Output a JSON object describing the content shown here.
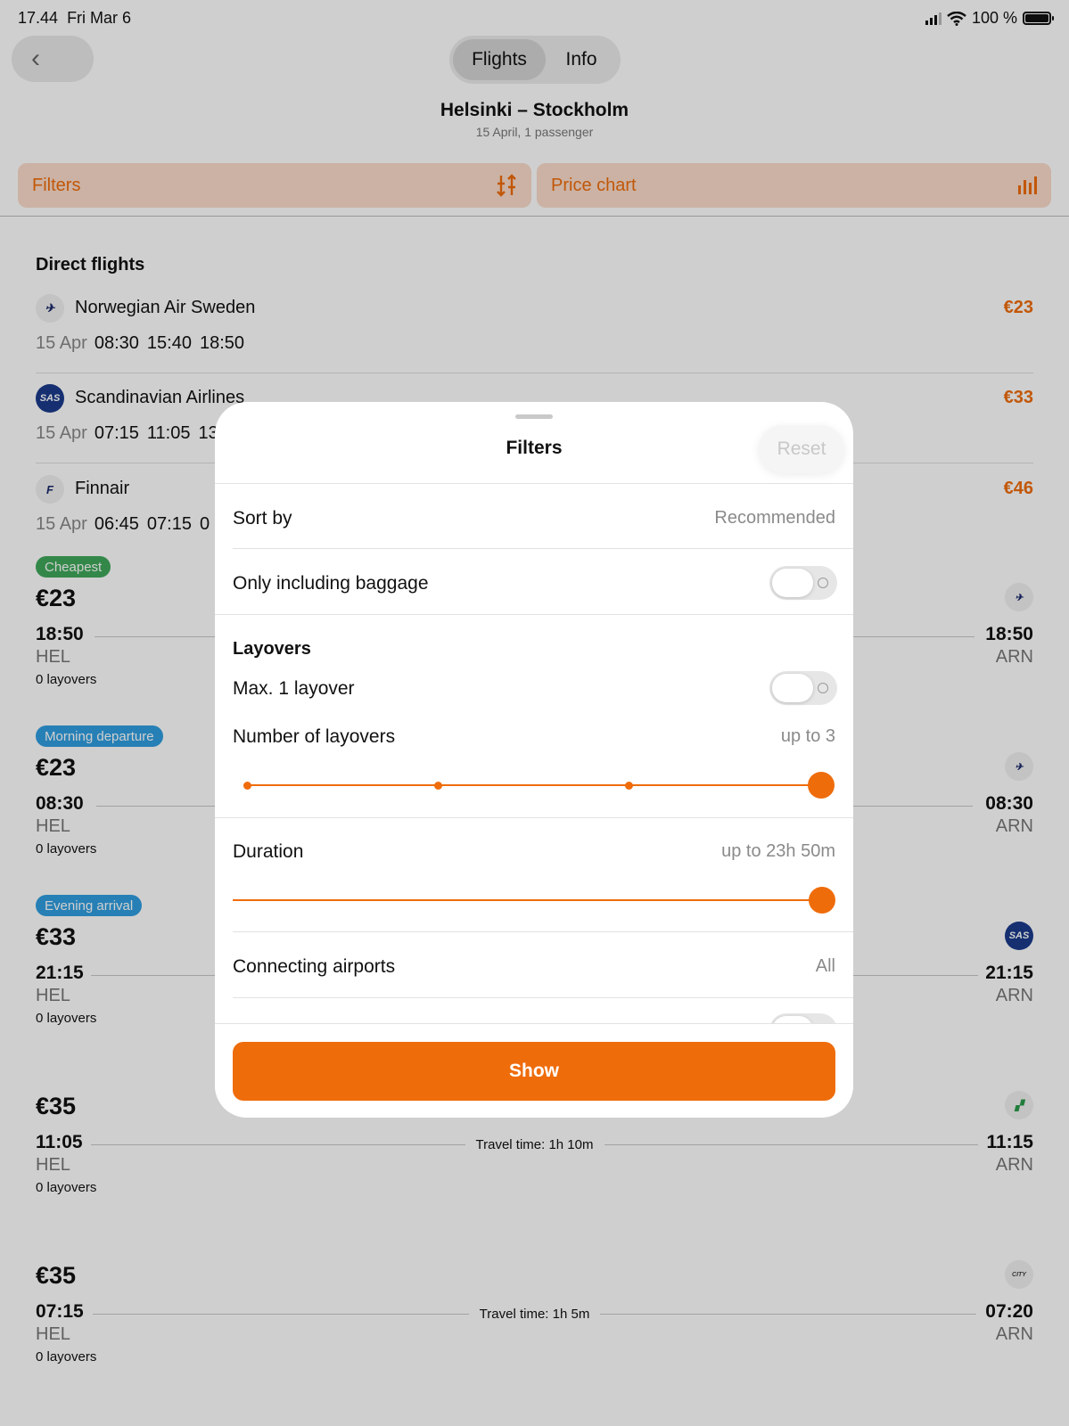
{
  "status": {
    "time": "17.44",
    "date": "Fri Mar 6",
    "battery": "100 %"
  },
  "header": {
    "tabs": [
      {
        "label": "Flights",
        "active": true
      },
      {
        "label": "Info",
        "active": false
      }
    ],
    "route": "Helsinki – Stockholm",
    "sub": "15 April, 1 passenger",
    "filters_label": "Filters",
    "price_chart_label": "Price chart"
  },
  "direct": {
    "title": "Direct flights",
    "rows": [
      {
        "airline": "Norwegian Air Sweden",
        "price": "€23",
        "date": "15 Apr",
        "times": [
          "08:30",
          "15:40",
          "18:50"
        ]
      },
      {
        "airline": "Scandinavian Airlines",
        "price": "€33",
        "date": "15 Apr",
        "times": [
          "07:15",
          "11:05",
          "13"
        ]
      },
      {
        "airline": "Finnair",
        "price": "€46",
        "date": "15 Apr",
        "times": [
          "06:45",
          "07:15",
          "0"
        ]
      }
    ]
  },
  "flights": [
    {
      "badge": "Cheapest",
      "badge_color": "#3fa85a",
      "price": "€23",
      "dep": "18:50",
      "arr": "18:50",
      "from": "HEL",
      "to": "ARN",
      "layovers": "0 layovers",
      "travel": ""
    },
    {
      "badge": "Morning departure",
      "badge_color": "#2f9ee0",
      "price": "€23",
      "dep": "08:30",
      "arr": "08:30",
      "from": "HEL",
      "to": "ARN",
      "layovers": "0 layovers",
      "travel": ""
    },
    {
      "badge": "Evening arrival",
      "badge_color": "#2f9ee0",
      "price": "€33",
      "dep": "21:15",
      "arr": "21:15",
      "from": "HEL",
      "to": "ARN",
      "layovers": "0 layovers",
      "travel": ""
    },
    {
      "badge": "",
      "price": "€35",
      "dep": "11:05",
      "arr": "11:15",
      "from": "HEL",
      "to": "ARN",
      "layovers": "0 layovers",
      "travel": "Travel time: 1h 10m"
    },
    {
      "badge": "",
      "price": "€35",
      "dep": "07:15",
      "arr": "07:20",
      "from": "HEL",
      "to": "ARN",
      "layovers": "0 layovers",
      "travel": "Travel time: 1h 5m"
    }
  ],
  "modal": {
    "title": "Filters",
    "reset": "Reset",
    "sort_label": "Sort by",
    "sort_value": "Recommended",
    "baggage_label": "Only including baggage",
    "baggage_on": false,
    "layovers_heading": "Layovers",
    "max_layover_label": "Max. 1 layover",
    "max_layover_on": false,
    "num_layovers_label": "Number of layovers",
    "num_layovers_value": "up to 3",
    "num_layovers_selected": 3,
    "num_layovers_max": 3,
    "duration_label": "Duration",
    "duration_value": "up to 23h 50m",
    "duration_fraction": 1.0,
    "airports_label": "Connecting airports",
    "airports_value": "All",
    "show_button": "Show"
  },
  "colors": {
    "accent": "#ef6c0b",
    "accent_light": "#fbdccb"
  }
}
